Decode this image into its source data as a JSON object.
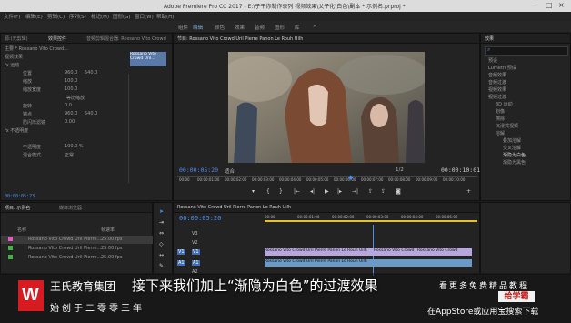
{
  "app": {
    "title": "Adobe Premiere Pro CC 2017 - E:\\子干你制作录列 视频效果\\父子化\\白色\\副本 * 示例名.prproj *",
    "menu": [
      "文件(F)",
      "编辑(E)",
      "剪辑(C)",
      "序列(S)",
      "标记(M)",
      "图形(G)",
      "窗口(W)",
      "帮助(H)"
    ],
    "workspaces": [
      "组件",
      "编辑",
      "颜色",
      "效果",
      "音频",
      "图形",
      "库",
      "»"
    ]
  },
  "effect_controls": {
    "tabs": [
      "源:(无剪辑)",
      "效果控件",
      "音频剪辑混合器: Rossano Vito Crowd",
      "元数据"
    ],
    "header": "主要 * Rossano Vito Crowd...",
    "clip_label": "Rossano Vito Crowd Uril...",
    "rows": [
      {
        "label": "视频效果",
        "v1": "",
        "v2": ""
      },
      {
        "label": "fx 运动",
        "v1": "",
        "v2": ""
      },
      {
        "label": "位置",
        "v1": "960.0",
        "v2": "540.0"
      },
      {
        "label": "缩放",
        "v1": "100.0",
        "v2": ""
      },
      {
        "label": "缩放宽度",
        "v1": "100.0",
        "v2": ""
      },
      {
        "label": "",
        "v1": "等比缩放",
        "v2": ""
      },
      {
        "label": "旋转",
        "v1": "0.0",
        "v2": ""
      },
      {
        "label": "锚点",
        "v1": "960.0",
        "v2": "540.0"
      },
      {
        "label": "防闪烁滤镜",
        "v1": "0.00",
        "v2": ""
      },
      {
        "label": "fx 不透明度",
        "v1": "",
        "v2": ""
      },
      {
        "label": "不透明度",
        "v1": "100.0 %",
        "v2": ""
      },
      {
        "label": "混合模式",
        "v1": "正常",
        "v2": ""
      }
    ],
    "timecode": "00:00:05:23"
  },
  "program_monitor": {
    "tab": "节目: Rossano Vito Crowd Uril Pierre Panon Le Rouh Uilh",
    "timecode_left": "00:00:05:20",
    "fit": "适合",
    "zoom": "1/2",
    "timecode_right": "00:00:10:01",
    "ruler": [
      "00:00",
      "00:00:01:00",
      "00:00:02:00",
      "00:00:03:00",
      "00:00:04:00",
      "00:00:05:00",
      "00:00:06:00",
      "00:00:07:00",
      "00:00:08:00",
      "00:00:09:00",
      "00:00:10:00"
    ]
  },
  "effects_panel": {
    "tab": "效果",
    "search_placeholder": "",
    "items": [
      "预设",
      "Lumetri 预设",
      "音频效果",
      "音频过渡",
      "视频效果",
      "视频过渡",
      "3D 运动",
      "划像",
      "擦除",
      "沉浸式视频",
      "溶解",
      "叠加溶解",
      "交叉溶解",
      "渐隐为白色",
      "渐隐为黑色"
    ]
  },
  "project_panel": {
    "tabs": [
      "项目: 示例名",
      "媒体浏览器"
    ],
    "header_name": "名称",
    "header_fps": "帧速率",
    "items": [
      {
        "name": "Rossano Vito Crowd Uril Pierre...",
        "fps": "25.00 fps",
        "color": "#e05cbf"
      },
      {
        "name": "Rossano Vito Crowd Uril Pierre...",
        "fps": "25.00 fps",
        "color": "#48b048"
      },
      {
        "name": "Rossano Vito Crowd Uril Pierre...",
        "fps": "25.00 fps",
        "color": "#48b048"
      }
    ]
  },
  "timeline": {
    "tab": "Rossano Vito Crowd Uril Pierre Panon Le Rouh Uilh",
    "timecode": "00:00:05:20",
    "ruler": [
      "00:00",
      "00:00:01:00",
      "00:00:02:00",
      "00:00:03:00",
      "00:00:04:00",
      "00:00:05:00",
      "00:00:06:00"
    ],
    "tracks": [
      "V3",
      "V2",
      "V1",
      "A1",
      "A2",
      "A3"
    ],
    "clip_v1_a": "Rossano Vito Crowd Uril Pierre Panon Le Rouh Uilh",
    "clip_v1_b": "Rossano Vito Crowd",
    "clip_v1_c": "Rossano Vito Crowd",
    "clip_a1_a": "Rossano Vito Crowd Uril Pierre Panon Le Rouh Uilh"
  },
  "overlay": {
    "company": "王氏教育集团",
    "slogan": "始创于二零零三年",
    "subtitle": "接下来我们加上“渐隐为白色”的过渡效果",
    "promo": "看更多免费精品教程",
    "badge": "给学霸",
    "appstore": "在AppStore或应用宝搜索下载"
  }
}
